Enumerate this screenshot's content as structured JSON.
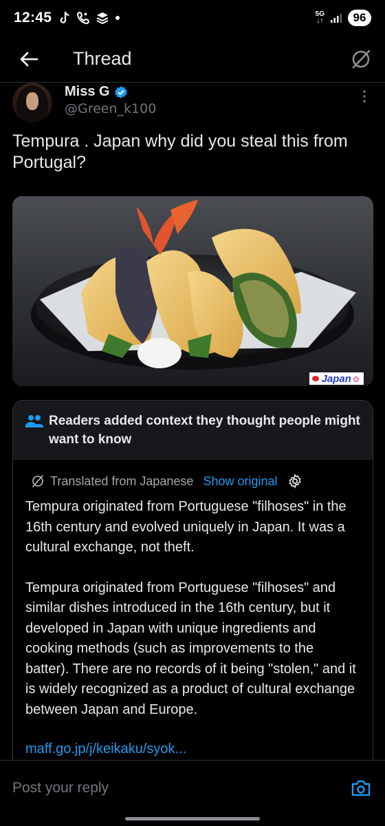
{
  "status_bar": {
    "time": "12:45",
    "network": "5G",
    "battery": "96",
    "icons": [
      "tiktok-icon",
      "call-icon",
      "stack-icon",
      "dot-icon",
      "signal-icon"
    ]
  },
  "header": {
    "title": "Thread",
    "back_icon": "arrow-left-icon",
    "action_icon": "grok-slash-icon"
  },
  "post": {
    "author_name": "Miss G",
    "author_handle": "@Green_k100",
    "verified": true,
    "text": "Tempura . Japan why did you steal this from Portugal?",
    "image_watermark": "Japan"
  },
  "community_note": {
    "header": "Readers added context they thought people might want to know",
    "translated_label": "Translated from Japanese",
    "show_original_label": "Show original",
    "paragraph_1": "Tempura originated from Portuguese \"filhoses\" in the 16th century and evolved uniquely in Japan. It was a cultural exchange, not theft.",
    "paragraph_2": "Tempura originated from Portuguese \"filhoses\" and similar dishes introduced in the 16th century, but it developed in Japan with unique ingredients and cooking methods (such as improvements to the batter). There are no records of it being \"stolen,\" and it is widely recognized as a product of cultural exchange between Japan and Europe.",
    "link": "maff.go.jp/j/keikaku/syok..."
  },
  "reply": {
    "placeholder": "Post your reply"
  },
  "colors": {
    "background": "#000000",
    "accent": "#1d9bf0",
    "secondary_text": "#71767b",
    "note_header_bg": "#16181c",
    "border": "#2f3336"
  }
}
